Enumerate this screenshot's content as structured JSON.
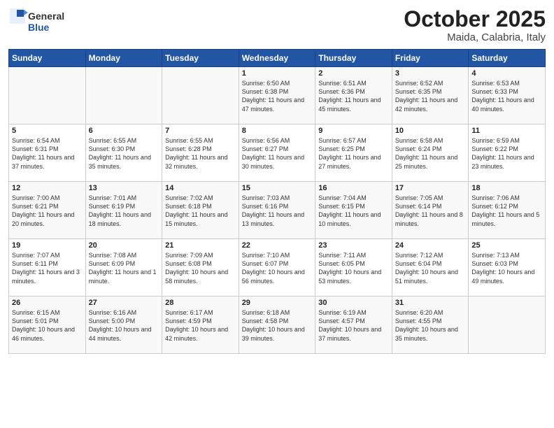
{
  "header": {
    "logo_general": "General",
    "logo_blue": "Blue",
    "month": "October 2025",
    "location": "Maida, Calabria, Italy"
  },
  "weekdays": [
    "Sunday",
    "Monday",
    "Tuesday",
    "Wednesday",
    "Thursday",
    "Friday",
    "Saturday"
  ],
  "weeks": [
    [
      {
        "day": "",
        "content": ""
      },
      {
        "day": "",
        "content": ""
      },
      {
        "day": "",
        "content": ""
      },
      {
        "day": "1",
        "content": "Sunrise: 6:50 AM\nSunset: 6:38 PM\nDaylight: 11 hours\nand 47 minutes."
      },
      {
        "day": "2",
        "content": "Sunrise: 6:51 AM\nSunset: 6:36 PM\nDaylight: 11 hours\nand 45 minutes."
      },
      {
        "day": "3",
        "content": "Sunrise: 6:52 AM\nSunset: 6:35 PM\nDaylight: 11 hours\nand 42 minutes."
      },
      {
        "day": "4",
        "content": "Sunrise: 6:53 AM\nSunset: 6:33 PM\nDaylight: 11 hours\nand 40 minutes."
      }
    ],
    [
      {
        "day": "5",
        "content": "Sunrise: 6:54 AM\nSunset: 6:31 PM\nDaylight: 11 hours\nand 37 minutes."
      },
      {
        "day": "6",
        "content": "Sunrise: 6:55 AM\nSunset: 6:30 PM\nDaylight: 11 hours\nand 35 minutes."
      },
      {
        "day": "7",
        "content": "Sunrise: 6:55 AM\nSunset: 6:28 PM\nDaylight: 11 hours\nand 32 minutes."
      },
      {
        "day": "8",
        "content": "Sunrise: 6:56 AM\nSunset: 6:27 PM\nDaylight: 11 hours\nand 30 minutes."
      },
      {
        "day": "9",
        "content": "Sunrise: 6:57 AM\nSunset: 6:25 PM\nDaylight: 11 hours\nand 27 minutes."
      },
      {
        "day": "10",
        "content": "Sunrise: 6:58 AM\nSunset: 6:24 PM\nDaylight: 11 hours\nand 25 minutes."
      },
      {
        "day": "11",
        "content": "Sunrise: 6:59 AM\nSunset: 6:22 PM\nDaylight: 11 hours\nand 23 minutes."
      }
    ],
    [
      {
        "day": "12",
        "content": "Sunrise: 7:00 AM\nSunset: 6:21 PM\nDaylight: 11 hours\nand 20 minutes."
      },
      {
        "day": "13",
        "content": "Sunrise: 7:01 AM\nSunset: 6:19 PM\nDaylight: 11 hours\nand 18 minutes."
      },
      {
        "day": "14",
        "content": "Sunrise: 7:02 AM\nSunset: 6:18 PM\nDaylight: 11 hours\nand 15 minutes."
      },
      {
        "day": "15",
        "content": "Sunrise: 7:03 AM\nSunset: 6:16 PM\nDaylight: 11 hours\nand 13 minutes."
      },
      {
        "day": "16",
        "content": "Sunrise: 7:04 AM\nSunset: 6:15 PM\nDaylight: 11 hours\nand 10 minutes."
      },
      {
        "day": "17",
        "content": "Sunrise: 7:05 AM\nSunset: 6:14 PM\nDaylight: 11 hours\nand 8 minutes."
      },
      {
        "day": "18",
        "content": "Sunrise: 7:06 AM\nSunset: 6:12 PM\nDaylight: 11 hours\nand 5 minutes."
      }
    ],
    [
      {
        "day": "19",
        "content": "Sunrise: 7:07 AM\nSunset: 6:11 PM\nDaylight: 11 hours\nand 3 minutes."
      },
      {
        "day": "20",
        "content": "Sunrise: 7:08 AM\nSunset: 6:09 PM\nDaylight: 11 hours\nand 1 minute."
      },
      {
        "day": "21",
        "content": "Sunrise: 7:09 AM\nSunset: 6:08 PM\nDaylight: 10 hours\nand 58 minutes."
      },
      {
        "day": "22",
        "content": "Sunrise: 7:10 AM\nSunset: 6:07 PM\nDaylight: 10 hours\nand 56 minutes."
      },
      {
        "day": "23",
        "content": "Sunrise: 7:11 AM\nSunset: 6:05 PM\nDaylight: 10 hours\nand 53 minutes."
      },
      {
        "day": "24",
        "content": "Sunrise: 7:12 AM\nSunset: 6:04 PM\nDaylight: 10 hours\nand 51 minutes."
      },
      {
        "day": "25",
        "content": "Sunrise: 7:13 AM\nSunset: 6:03 PM\nDaylight: 10 hours\nand 49 minutes."
      }
    ],
    [
      {
        "day": "26",
        "content": "Sunrise: 6:15 AM\nSunset: 5:01 PM\nDaylight: 10 hours\nand 46 minutes."
      },
      {
        "day": "27",
        "content": "Sunrise: 6:16 AM\nSunset: 5:00 PM\nDaylight: 10 hours\nand 44 minutes."
      },
      {
        "day": "28",
        "content": "Sunrise: 6:17 AM\nSunset: 4:59 PM\nDaylight: 10 hours\nand 42 minutes."
      },
      {
        "day": "29",
        "content": "Sunrise: 6:18 AM\nSunset: 4:58 PM\nDaylight: 10 hours\nand 39 minutes."
      },
      {
        "day": "30",
        "content": "Sunrise: 6:19 AM\nSunset: 4:57 PM\nDaylight: 10 hours\nand 37 minutes."
      },
      {
        "day": "31",
        "content": "Sunrise: 6:20 AM\nSunset: 4:55 PM\nDaylight: 10 hours\nand 35 minutes."
      },
      {
        "day": "",
        "content": ""
      }
    ]
  ]
}
